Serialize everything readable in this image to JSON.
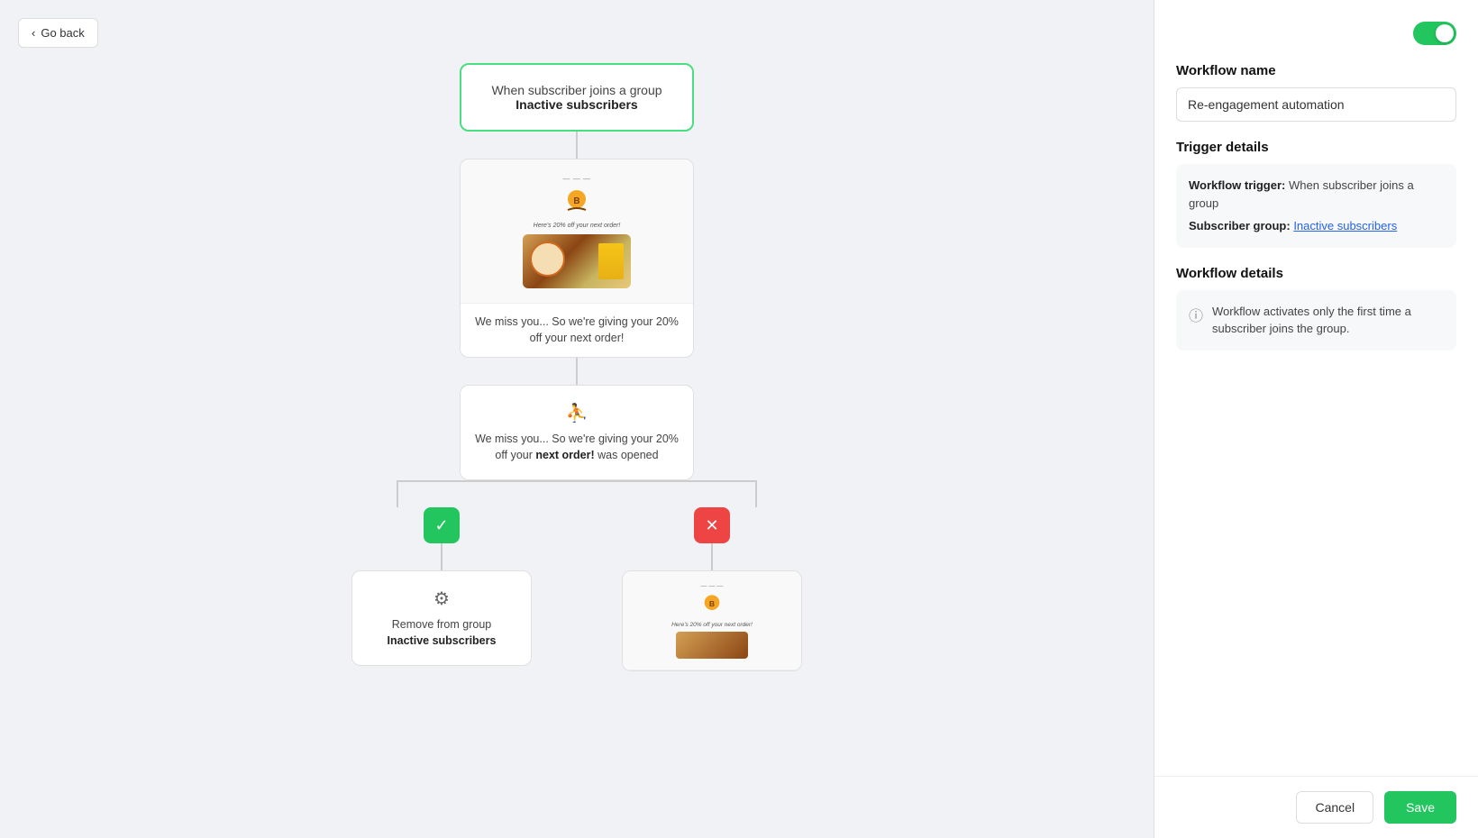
{
  "goBack": {
    "label": "Go back"
  },
  "trigger": {
    "text_before": "When subscriber joins a group",
    "text_bold": "Inactive subscribers"
  },
  "emailNode": {
    "headerText": "Here's 20% off your next order!",
    "bodyText": "We miss you... So we're giving your 20% off your next order!"
  },
  "conditionNode": {
    "conditionText_before": "We miss you... So we're giving your 20% off your",
    "conditionText_bold": "next order!",
    "conditionText_after": " was opened"
  },
  "leftBranch": {
    "actionTextBefore": "Remove from group",
    "actionTextBold": "Inactive subscribers"
  },
  "rightBranch": {
    "emailHeaderText": "Here's 20% off your next order!"
  },
  "rightPanel": {
    "workflowName": {
      "label": "Workflow name"
    },
    "workflowNameValue": "Re-engagement automation",
    "triggerDetails": {
      "label": "Trigger details"
    },
    "triggerRow1Label": "Workflow trigger:",
    "triggerRow1Value": " When subscriber joins a group",
    "triggerRow2Label": "Subscriber group:",
    "triggerRow2Link": "Inactive subscribers",
    "workflowDetails": {
      "label": "Workflow details"
    },
    "workflowDetailText": "Workflow activates only the first time a subscriber joins the group.",
    "cancelBtn": "Cancel",
    "saveBtn": "Save"
  }
}
